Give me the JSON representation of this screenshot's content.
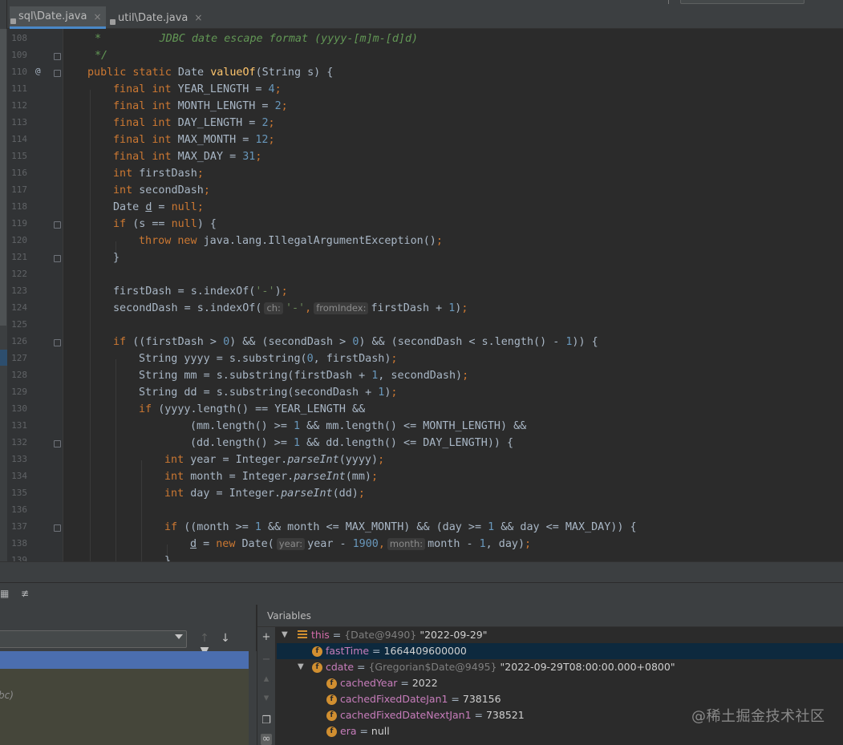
{
  "tabs": [
    {
      "label": "sql\\Date.java",
      "active": true,
      "icon": "java-class-icon",
      "close": "×"
    },
    {
      "label": "util\\Date.java",
      "active": false,
      "icon": "java-class-icon",
      "close": "×"
    }
  ],
  "gutter": {
    "override_marker": "@"
  },
  "code": {
    "l108": {
      "num": "108",
      "text": "*         JDBC date escape format (yyyy-[m]m-[d]d)"
    },
    "l109": {
      "num": "109",
      "text": "*/"
    },
    "l110": {
      "num": "110",
      "kw": "public static",
      "type": "Date",
      "fn": "valueOf",
      "rest": "(String s) {"
    },
    "l111": {
      "num": "111",
      "kw": "final int",
      "name": "YEAR_LENGTH",
      "eq": " = ",
      "val": "4",
      "end": ";"
    },
    "l112": {
      "num": "112",
      "kw": "final int",
      "name": "MONTH_LENGTH",
      "eq": " = ",
      "val": "2",
      "end": ";"
    },
    "l113": {
      "num": "113",
      "kw": "final int",
      "name": "DAY_LENGTH",
      "eq": " = ",
      "val": "2",
      "end": ";"
    },
    "l114": {
      "num": "114",
      "kw": "final int",
      "name": "MAX_MONTH",
      "eq": " = ",
      "val": "12",
      "end": ";"
    },
    "l115": {
      "num": "115",
      "kw": "final int",
      "name": "MAX_DAY",
      "eq": " = ",
      "val": "31",
      "end": ";"
    },
    "l116": {
      "num": "116",
      "kw": "int",
      "name": "firstDash",
      "end": ";"
    },
    "l117": {
      "num": "117",
      "kw": "int",
      "name": "secondDash",
      "end": ";"
    },
    "l118": {
      "num": "118",
      "type": "Date",
      "name": "d",
      "eq": " = ",
      "kw2": "null",
      "end": ";"
    },
    "l119": {
      "num": "119",
      "kw": "if",
      "rest": "(s == ",
      "kw2": "null",
      "rest2": ") {"
    },
    "l120": {
      "num": "120",
      "kw": "throw new",
      "rest": "java.lang.IllegalArgumentException()",
      "end": ";"
    },
    "l121": {
      "num": "121",
      "text": "}"
    },
    "l122": {
      "num": "122"
    },
    "l123": {
      "num": "123",
      "a": "firstDash = s.indexOf(",
      "s": "'-'",
      "b": ")",
      "end": ";"
    },
    "l124": {
      "num": "124",
      "a": "secondDash = s.indexOf(",
      "h1": "ch:",
      "s": "'-'",
      "comma": ",",
      "h2": "fromIndex:",
      "b": "firstDash + ",
      "n": "1",
      "c": ")",
      "end": ";"
    },
    "l125": {
      "num": "125"
    },
    "l126": {
      "num": "126",
      "kw": "if",
      "a": "((firstDash > ",
      "n1": "0",
      "b": ") && (secondDash > ",
      "n2": "0",
      "c": ") && (secondDash < s.length() - ",
      "n3": "1",
      "d": ")) {"
    },
    "l127": {
      "num": "127",
      "a": "String yyyy = s.substring(",
      "n1": "0",
      "b": ", firstDash)",
      "end": ";"
    },
    "l128": {
      "num": "128",
      "a": "String mm = s.substring(firstDash + ",
      "n1": "1",
      "b": ", secondDash)",
      "end": ";"
    },
    "l129": {
      "num": "129",
      "a": "String dd = s.substring(secondDash + ",
      "n1": "1",
      "b": ")",
      "end": ";"
    },
    "l130": {
      "num": "130",
      "kw": "if",
      "a": "(yyyy.length() == YEAR_LENGTH &&"
    },
    "l131": {
      "num": "131",
      "a": "(mm.length() >= ",
      "n1": "1",
      "b": " && mm.length() <= MONTH_LENGTH) &&"
    },
    "l132": {
      "num": "132",
      "a": "(dd.length() >= ",
      "n1": "1",
      "b": " && dd.length() <= DAY_LENGTH)) {"
    },
    "l133": {
      "num": "133",
      "kw": "int",
      "a": "year = Integer.",
      "it": "parseInt",
      "b": "(yyyy)",
      "end": ";"
    },
    "l134": {
      "num": "134",
      "kw": "int",
      "a": "month = Integer.",
      "it": "parseInt",
      "b": "(mm)",
      "end": ";"
    },
    "l135": {
      "num": "135",
      "kw": "int",
      "a": "day = Integer.",
      "it": "parseInt",
      "b": "(dd)",
      "end": ";"
    },
    "l136": {
      "num": "136"
    },
    "l137": {
      "num": "137",
      "kw": "if",
      "a": "((month >= ",
      "n1": "1",
      "b": " && month <= MAX_MONTH) && (day >= ",
      "n2": "1",
      "c": " && day <= MAX_DAY)) {"
    },
    "l138": {
      "num": "138",
      "name": "d",
      "eq": " = ",
      "kw": "new",
      "a": "Date(",
      "h1": "year:",
      "b": "year - ",
      "n1": "1900",
      "comma": ",",
      "h2": "month:",
      "c": "month - ",
      "n2": "1",
      "d": ", day)",
      "end": ";"
    },
    "l139": {
      "num": "139",
      "text": "}"
    }
  },
  "debugger": {
    "variables_title": "Variables",
    "frames_extra_text": "bc)",
    "nav": {
      "up": "↑",
      "down": "↓",
      "filter": "filter-icon"
    },
    "side": {
      "add": "+"
    },
    "vars": [
      {
        "name": "this",
        "eq": " = ",
        "type": "{Date@9490}",
        "value": "\"2022-09-29\"",
        "expanded": true,
        "icon": "field-list-icon"
      },
      {
        "name": "fastTime",
        "eq": " = ",
        "value": "1664409600000",
        "icon": "field-icon",
        "selected": true
      },
      {
        "name": "cdate",
        "eq": " = ",
        "type": "{Gregorian$Date@9495}",
        "value": "\"2022-09-29T08:00:00.000+0800\"",
        "expanded": true,
        "icon": "field-icon"
      },
      {
        "name": "cachedYear",
        "eq": " = ",
        "value": "2022",
        "icon": "field-icon"
      },
      {
        "name": "cachedFixedDateJan1",
        "eq": " = ",
        "value": "738156",
        "icon": "field-icon"
      },
      {
        "name": "cachedFixedDateNextJan1",
        "eq": " = ",
        "value": "738521",
        "icon": "field-icon"
      },
      {
        "name": "era",
        "eq": " = ",
        "value": "null",
        "icon": "field-icon"
      }
    ],
    "field_icon_letter": "f"
  },
  "watermark": "@稀土掘金技术社区"
}
